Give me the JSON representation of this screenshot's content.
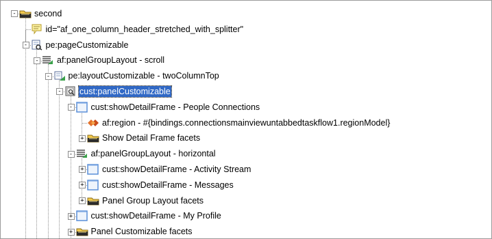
{
  "tree": {
    "nodes": [
      {
        "label": "second",
        "depth": 0,
        "icon": "folder-icon",
        "toggle": "-"
      },
      {
        "label": "id=\"af_one_column_header_stretched_with_splitter\"",
        "depth": 1,
        "icon": "comment-icon",
        "toggle": ""
      },
      {
        "label": "pe:pageCustomizable",
        "depth": 1,
        "icon": "page-customizable-icon",
        "toggle": "-"
      },
      {
        "label": "af:panelGroupLayout - scroll",
        "depth": 2,
        "icon": "panel-group-layout-icon",
        "toggle": "-"
      },
      {
        "label": "pe:layoutCustomizable - twoColumnTop",
        "depth": 3,
        "icon": "layout-customizable-icon",
        "toggle": "-"
      },
      {
        "label": "cust:panelCustomizable",
        "depth": 4,
        "icon": "panel-customizable-icon",
        "toggle": "-",
        "selected": true
      },
      {
        "label": "cust:showDetailFrame - People Connections",
        "depth": 5,
        "icon": "show-detail-frame-icon",
        "toggle": "-"
      },
      {
        "label": "af:region - #{bindings.connectionsmainviewuntabbedtaskflow1.regionModel}",
        "depth": 6,
        "icon": "region-icon",
        "toggle": ""
      },
      {
        "label": "Show Detail Frame facets",
        "depth": 6,
        "icon": "folder-icon",
        "toggle": "+"
      },
      {
        "label": "af:panelGroupLayout - horizontal",
        "depth": 5,
        "icon": "panel-group-layout-icon",
        "toggle": "-"
      },
      {
        "label": "cust:showDetailFrame - Activity Stream",
        "depth": 6,
        "icon": "show-detail-frame-icon",
        "toggle": "+"
      },
      {
        "label": "cust:showDetailFrame - Messages",
        "depth": 6,
        "icon": "show-detail-frame-icon",
        "toggle": "+"
      },
      {
        "label": "Panel Group Layout facets",
        "depth": 6,
        "icon": "folder-icon",
        "toggle": "+"
      },
      {
        "label": "cust:showDetailFrame - My Profile",
        "depth": 5,
        "icon": "show-detail-frame-icon",
        "toggle": "+"
      },
      {
        "label": "Panel Customizable facets",
        "depth": 5,
        "icon": "folder-icon",
        "toggle": "+"
      }
    ]
  },
  "colors": {
    "selection": "#3169c6",
    "folder": "#f2c94c",
    "frame_blue": "#5a8fd8"
  }
}
